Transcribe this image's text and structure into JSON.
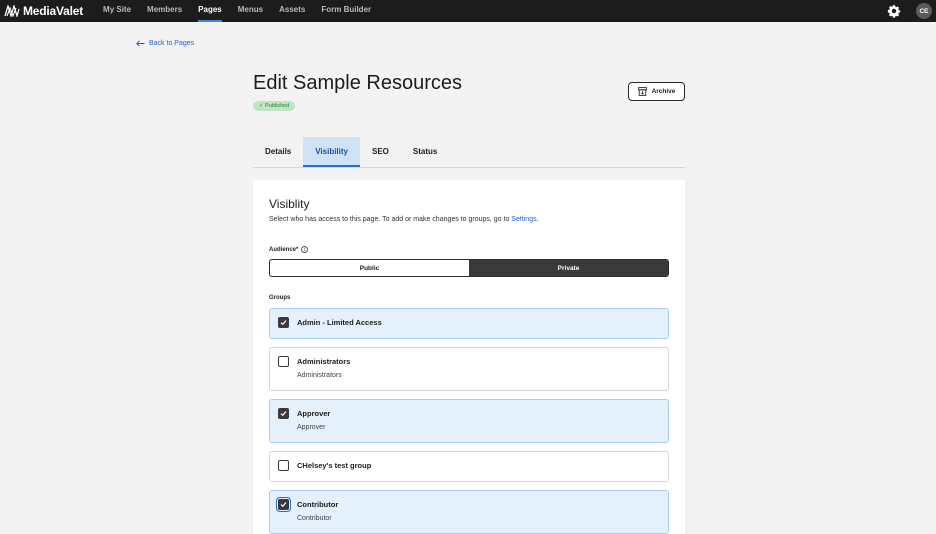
{
  "nav": {
    "brand": "MediaValet",
    "items": [
      {
        "label": "My Site",
        "active": false
      },
      {
        "label": "Members",
        "active": false
      },
      {
        "label": "Pages",
        "active": true
      },
      {
        "label": "Menus",
        "active": false
      },
      {
        "label": "Assets",
        "active": false
      },
      {
        "label": "Form Builder",
        "active": false
      }
    ],
    "settings_icon": "gear-icon",
    "avatar_initials": "CE"
  },
  "back_link": "Back to Pages",
  "page": {
    "title": "Edit Sample Resources",
    "status_badge": "✓ Published",
    "archive_label": "Archive"
  },
  "tabs": [
    {
      "label": "Details",
      "active": false
    },
    {
      "label": "Visibility",
      "active": true
    },
    {
      "label": "SEO",
      "active": false
    },
    {
      "label": "Status",
      "active": false
    }
  ],
  "visibility": {
    "heading": "Visiblity",
    "description": "Select who has access to this page. To add or make changes to groups, go to ",
    "settings_link": "Settings",
    "description_end": ".",
    "audience_label": "Audience*",
    "audience_options": [
      {
        "label": "Public",
        "selected": false
      },
      {
        "label": "Private",
        "selected": true
      }
    ],
    "groups_label": "Groups",
    "groups": [
      {
        "name": "Admin - Limited Access",
        "sub": "",
        "checked": true
      },
      {
        "name": "Administrators",
        "sub": "Administrators",
        "checked": false
      },
      {
        "name": "Approver",
        "sub": "Approver",
        "checked": true
      },
      {
        "name": "CHelsey's test group",
        "sub": "",
        "checked": false
      },
      {
        "name": "Contributor",
        "sub": "Contributor",
        "checked": true
      }
    ]
  },
  "colors": {
    "accent": "#2563c9",
    "nav_bg": "#1c1c1c",
    "selected_bg": "#e4f0fb",
    "published_badge_bg": "#bfe6c2"
  }
}
